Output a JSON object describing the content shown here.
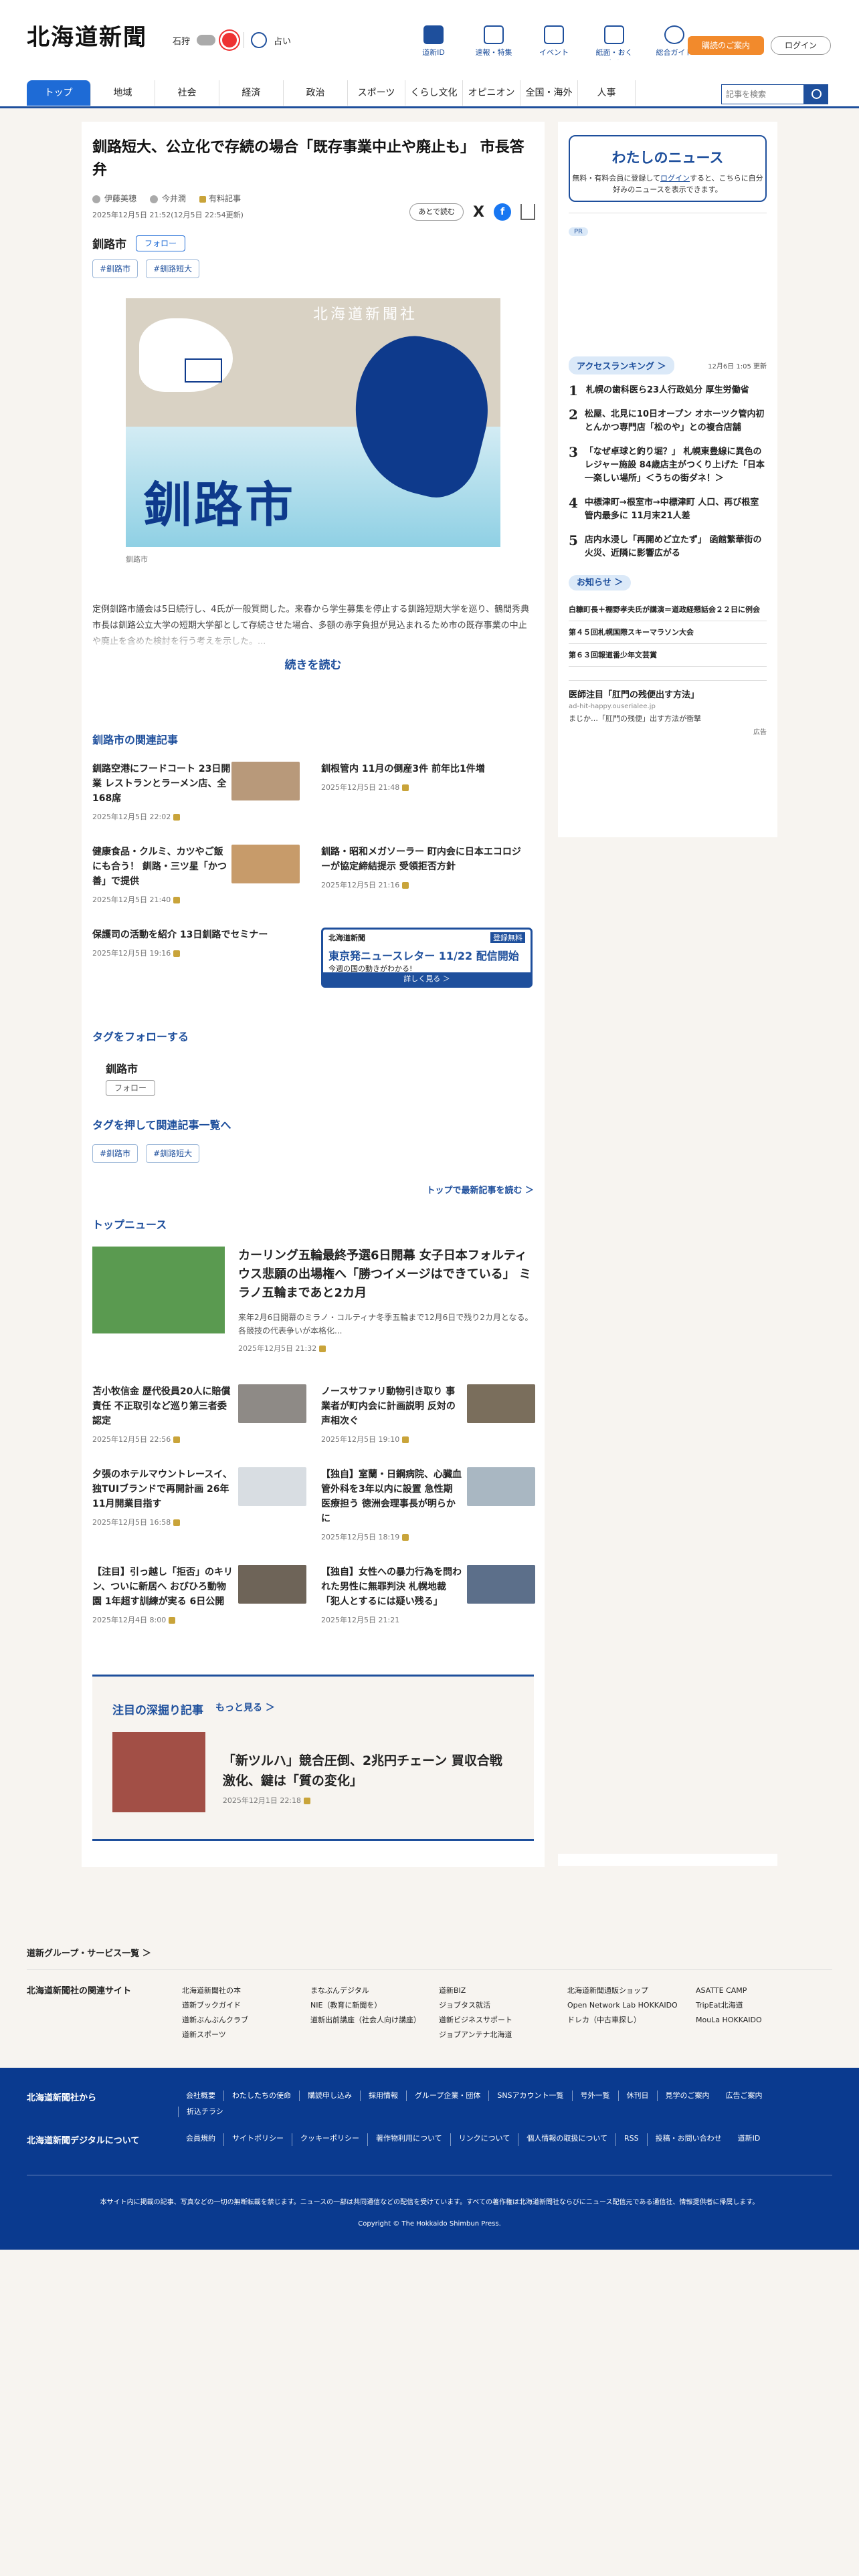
{
  "header": {
    "logo": "北海道新聞",
    "weather_area": "石狩",
    "uranai": "占い",
    "icons": [
      "道新ID",
      "速報・特集",
      "イベント",
      "紙面・おくやみ",
      "総合ガイド"
    ],
    "apply": "購読のご案内",
    "login": "ログイン"
  },
  "nav": {
    "items": [
      "トップ",
      "地域",
      "社会",
      "経済",
      "政治",
      "スポーツ",
      "くらし文化",
      "オピニオン",
      "全国・海外",
      "人事"
    ],
    "search_placeholder": "記事を検索"
  },
  "article": {
    "title": "釧路短大、公立化で存続の場合「既存事業中止や廃止も」 市長答弁",
    "authors": [
      "伊藤美穂",
      "今井潤"
    ],
    "badge": "有料記事",
    "dates": "2025年12月5日 21:52(12月5日 22:54更新)",
    "later": "あとで読む",
    "share_x": "X",
    "share_f": "f",
    "follow_tag": "釧路市",
    "follow": "フォロー",
    "tags": [
      "#釧路市",
      "#釧路短大"
    ],
    "fig_city": "釧路市",
    "fig_wm": "北海道新聞社",
    "caption": "釧路市",
    "lead": "定例釧路市議会は5日続行し、4氏が一般質問した。来春から学生募集を停止する釧路短期大学を巡り、鶴間秀典市長は釧路公立大学の短期大学部として存続させた場合、多額の赤字負担が見込まれるため市の既存事業の中止や廃止を含めた検討を行う考えを示した。...",
    "more": "続きを読む"
  },
  "related": {
    "heading": "釧路市の関連記事",
    "items": [
      {
        "title": "釧路空港にフードコート 23日開業 レストランとラーメン店、全168席",
        "date": "2025年12月5日 22:02"
      },
      {
        "title": "釧根管内 11月の倒産3件 前年比1件増",
        "date": "2025年12月5日 21:48"
      },
      {
        "title": "健康食品・クルミ、カツやご飯にも合う！ 釧路・三ツ星「かつ善」で提供",
        "date": "2025年12月5日 21:40"
      },
      {
        "title": "釧路・昭和メガソーラー 町内会に日本エコロジーが協定締結提示 受領拒否方針",
        "date": "2025年12月5日 21:16"
      },
      {
        "title": "保護司の活動を紹介 13日釧路でセミナー",
        "date": "2025年12月5日 19:16"
      }
    ],
    "ad": {
      "a1": "北海道新聞",
      "a2": "登録無料",
      "a3": "東京発ニュースレター 11/22 配信開始",
      "a4": "今週の国の動きがわかる!",
      "a5": "詳しく見る ＞"
    }
  },
  "tagfollow": {
    "heading": "タグをフォローする",
    "name": "釧路市",
    "follow": "フォロー",
    "heading2": "タグを押して関連記事一覧へ",
    "tags": [
      "#釧路市",
      "#釧路短大"
    ],
    "toplink": "トップで最新記事を読む ＞"
  },
  "topnews": {
    "heading": "トップニュース",
    "lead": {
      "title": "カーリング五輪最終予選6日開幕 女子日本フォルティウス悲願の出場権へ「勝つイメージはできている」 ミラノ五輪まであと2カ月",
      "summary": "来年2月6日開幕のミラノ・コルティナ冬季五輪まで12月6日で残り2カ月となる。各競技の代表争いが本格化...",
      "date": "2025年12月5日 21:32"
    },
    "items": [
      {
        "title": "苫小牧信金 歴代役員20人に賠償責任 不正取引など巡り第三者委認定",
        "date": "2025年12月5日 22:56"
      },
      {
        "title": "ノースサファリ動物引き取り 事業者が町内会に計画説明 反対の声相次ぐ",
        "date": "2025年12月5日 19:10"
      },
      {
        "title": "夕張のホテルマウントレースイ、独TUIブランドで再開計画 26年11月開業目指す",
        "date": "2025年12月5日 16:58"
      },
      {
        "title": "【独自】室蘭・日鋼病院、心臓血管外科を3年以内に設置 急性期医療担う 徳洲会理事長が明らかに",
        "date": "2025年12月5日 18:19"
      },
      {
        "title": "【注目】引っ越し「拒否」のキリン、ついに新居へ おびひろ動物園 1年超す訓練が実る 6日公開",
        "date": "2025年12月4日 8:00"
      },
      {
        "title": "【独自】女性への暴力行為を問われた男性に無罪判決 札幌地裁「犯人とするには疑い残る」",
        "date": "2025年12月5日 21:21"
      }
    ]
  },
  "deep": {
    "heading": "注目の深掘り記事",
    "more": "もっと見る ＞",
    "title": "「新ツルハ」競合圧倒、2兆円チェーン 買収合戦激化、鍵は「質の変化」",
    "date": "2025年12月1日 22:18"
  },
  "side": {
    "mynews_title": "わたしのニュース",
    "mynews_text1": "無料・有料会員に登録して",
    "mynews_login": "ログイン",
    "mynews_text2": "すると、こちらに自分好みのニュースを表示できます。",
    "pr": "PR",
    "rank_heading": "アクセスランキング ＞",
    "rank_updated": "12月6日 1:05 更新",
    "rank": [
      "札幌の歯科医ら23人行政処分 厚生労働省",
      "松屋、北見に10日オープン オホーツク管内初 とんかつ専門店「松のや」との複合店舗",
      "「なぜ卓球と釣り堀？」 札幌東豊線に異色のレジャー施設 84歳店主がつくり上げた「日本一楽しい場所」＜うちの街ダネ！＞",
      "中標津町→根室市→中標津町 人口、再び根室管内最多に 11月末21人差",
      "店内水浸し「再開めど立たず」 函館繁華街の火災、近隣に影響広がる"
    ],
    "notice_heading": "お知らせ ＞",
    "notices": [
      "白糠町長＋棚野孝夫氏が講演＝道政経懇話会２２日に例会",
      "第４５回札幌国際スキーマラソン大会",
      "第６３回報道番少年文芸賞"
    ],
    "ad_title": "医師注目「肛門の残便出す方法」",
    "ad_url": "ad-hit-happy.ouserialee.jp",
    "ad_text": "まじか…「肛門の残便」出す方法が衝撃",
    "ad_label": "広告"
  },
  "group": {
    "heading": "道新グループ・サービス一覧 ＞",
    "sites_label": "北海道新聞社の関連サイト",
    "cols": [
      [
        "北海道新聞社の本",
        "道新ブックガイド",
        "道新ぶんぶんクラブ",
        "道新スポーツ"
      ],
      [
        "まなぶんデジタル",
        "NIE（教育に新聞を）",
        "道新出前講座（社会人向け講座）"
      ],
      [
        "道新BIZ",
        "ジョブタス就活",
        "道新ビジネスサポート",
        "ジョブアンテナ北海道"
      ],
      [
        "北海道新聞通販ショップ",
        "Open Network Lab HOKKAIDO",
        "ドレカ（中古車探し）"
      ],
      [
        "ASATTE CAMP",
        "TripEat北海道",
        "MouLa HOKKAIDO"
      ]
    ]
  },
  "footer": {
    "row1_label": "北海道新聞社から",
    "row1": [
      "会社概要",
      "わたしたちの使命",
      "購読申し込み",
      "採用情報",
      "グループ企業・団体",
      "SNSアカウント一覧",
      "号外一覧",
      "休刊日",
      "見学のご案内",
      "広告ご案内",
      "折込チラシ"
    ],
    "row2_label": "北海道新聞デジタルについて",
    "row2": [
      "会員規約",
      "サイトポリシー",
      "クッキーポリシー",
      "著作物利用について",
      "リンクについて",
      "個人情報の取扱について",
      "RSS",
      "投稿・お問い合わせ",
      "道新ID"
    ],
    "disclaimer": "本サイト内に掲載の記事、写真などの一切の無断転載を禁じます。ニュースの一部は共同通信などの配信を受けています。すべての著作権は北海道新聞社ならびにニュース配信元である通信社、情報提供者に帰属します。",
    "copyright": "Copyright © The Hokkaido Shimbun Press."
  }
}
